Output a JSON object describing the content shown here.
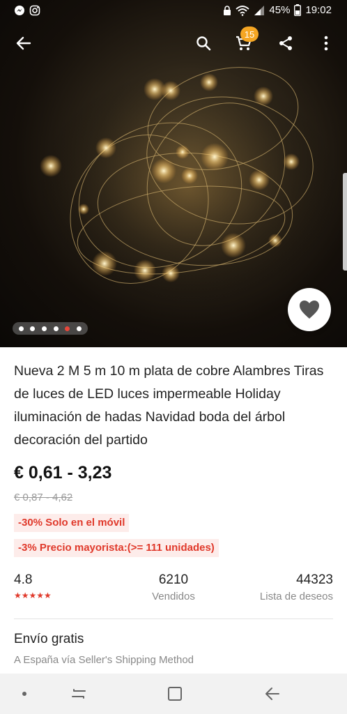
{
  "status_bar": {
    "battery": "45%",
    "time": "19:02",
    "icons": [
      "messenger-icon",
      "instagram-icon",
      "lock-icon",
      "wifi-icon",
      "signal-icon",
      "battery-icon"
    ]
  },
  "toolbar": {
    "cart_count": "15",
    "icons": [
      "back-arrow-icon",
      "search-icon",
      "cart-icon",
      "share-icon",
      "more-vert-icon"
    ]
  },
  "gallery": {
    "dot_count": 6,
    "active_index": 4
  },
  "product": {
    "title": "Nueva 2 M 5 m 10 m plata de cobre Alambres Tiras de luces de LED luces impermeable Holiday iluminación de hadas Navidad boda del árbol decoración del partido",
    "price": "€ 0,61 - 3,23",
    "original_price": "€ 0,87 - 4,62",
    "promo_mobile": "-30% Solo en el móvil",
    "promo_wholesale": "-3% Precio mayorista:(>= 111 unidades)"
  },
  "stats": {
    "rating": "4.8",
    "stars": "★★★★★",
    "sold": "6210",
    "sold_label": "Vendidos",
    "wishlist": "44323",
    "wishlist_label": "Lista de deseos"
  },
  "shipping": {
    "title": "Envío gratis",
    "subtitle": "A España vía Seller's Shipping Method"
  },
  "colors": {
    "accent_red": "#e0392b",
    "badge_orange": "#f5a623"
  }
}
